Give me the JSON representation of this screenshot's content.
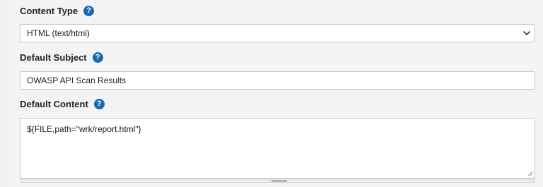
{
  "fields": {
    "content_type": {
      "label": "Content Type",
      "value": "HTML (text/html)"
    },
    "default_subject": {
      "label": "Default Subject",
      "value": "OWASP API Scan Results"
    },
    "default_content": {
      "label": "Default Content",
      "value": "${FILE,path=\"wrk/report.html\"}"
    }
  },
  "help_glyph": "?",
  "colors": {
    "help_icon": "#1a6aad",
    "background": "#f4f4f4",
    "input_border": "#c6c6c6"
  },
  "icons": [
    "help-icon",
    "chevron-down-icon",
    "resize-grip-icon",
    "drag-handle-icon"
  ]
}
